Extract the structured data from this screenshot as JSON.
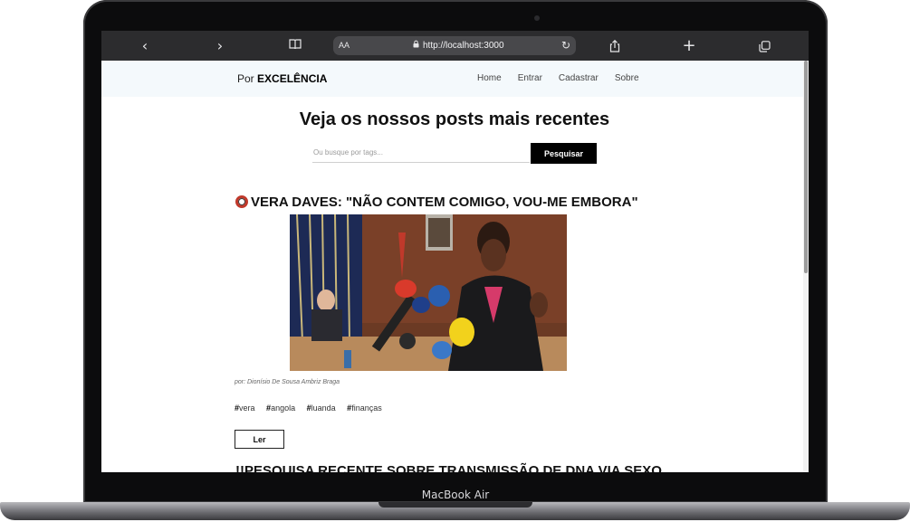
{
  "device": {
    "label": "MacBook Air"
  },
  "browser": {
    "url": "http://localhost:3000",
    "text_size_label": "AA"
  },
  "site": {
    "brand_prefix": "Por",
    "brand_name": "EXCELÊNCIA",
    "nav": [
      "Home",
      "Entrar",
      "Cadastrar",
      "Sobre"
    ]
  },
  "main": {
    "title": "Veja os nossos posts mais recentes",
    "search_placeholder": "Ou busque por tags...",
    "search_button": "Pesquisar"
  },
  "posts": [
    {
      "title": "VERA DAVES: \"NÃO CONTEM COMIGO, VOU-ME EMBORA\"",
      "author": "por: Dionísio De Sousa Ambriz Braga",
      "tags": [
        "vera",
        "angola",
        "luanda",
        "finanças"
      ],
      "read_button": "Ler"
    },
    {
      "title": "!!PESQUISA RECENTE SOBRE TRANSMISSÃO DE DNA VIA SEXO"
    }
  ],
  "colors": {
    "nav_bg": "#f4f9fc",
    "button_dark": "#000000",
    "toolbar_bg": "#2c2c2e"
  }
}
